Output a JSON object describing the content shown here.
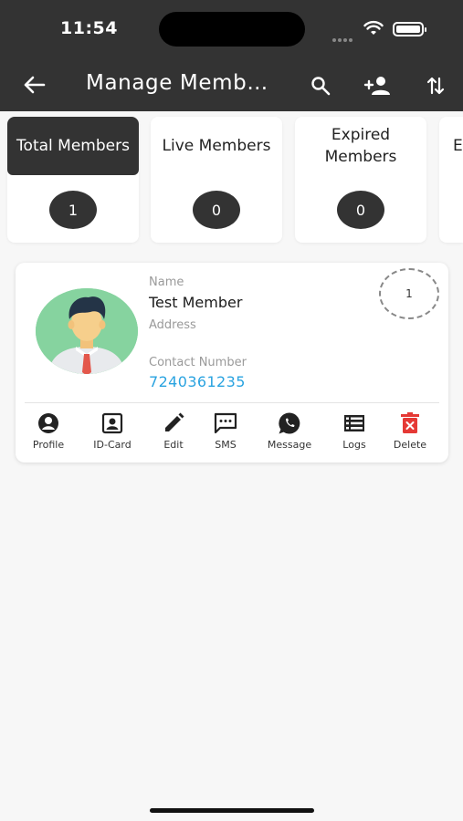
{
  "status_bar": {
    "time": "11:54"
  },
  "app_bar": {
    "title": "Manage Members",
    "icons": [
      "back-arrow-icon",
      "search-icon",
      "add-person-icon",
      "sort-icon"
    ]
  },
  "stats": [
    {
      "label": "Total Members",
      "count": "1",
      "active": true
    },
    {
      "label": "Live Members",
      "count": "0",
      "active": false
    },
    {
      "label": "Expired Members",
      "count": "0",
      "active": false
    },
    {
      "label": "E",
      "count": "",
      "active": false
    }
  ],
  "member": {
    "name_label": "Name",
    "name": "Test Member",
    "address_label": "Address",
    "contact_label": "Contact Number",
    "contact": "7240361235",
    "badge": "1",
    "actions": [
      {
        "label": "Profile",
        "icon": "profile-icon"
      },
      {
        "label": "ID-Card",
        "icon": "id-card-icon"
      },
      {
        "label": "Edit",
        "icon": "edit-icon"
      },
      {
        "label": "SMS",
        "icon": "sms-icon"
      },
      {
        "label": "Message",
        "icon": "whatsapp-icon"
      },
      {
        "label": "Logs",
        "icon": "logs-icon"
      },
      {
        "label": "Delete",
        "icon": "delete-icon"
      }
    ]
  },
  "colors": {
    "app_bar": "#333333",
    "accent_link": "#2aa3e0",
    "delete": "#e53935"
  }
}
